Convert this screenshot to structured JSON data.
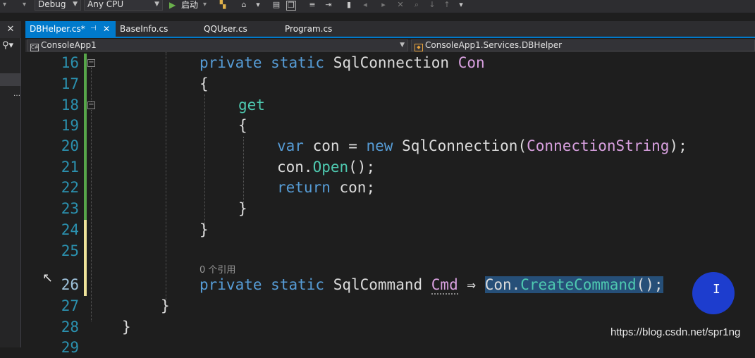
{
  "toolbar": {
    "config": "Debug",
    "platform": "Any CPU",
    "start_label": "启动"
  },
  "tabs": [
    {
      "label": "DBHelper.cs*",
      "active": true
    },
    {
      "label": "BaseInfo.cs"
    },
    {
      "label": "QQUser.cs"
    },
    {
      "label": "Program.cs"
    }
  ],
  "nav": {
    "project": "ConsoleApp1",
    "type": "ConsoleApp1.Services.DBHelper"
  },
  "code": {
    "line_numbers": [
      "16",
      "17",
      "18",
      "19",
      "20",
      "21",
      "22",
      "23",
      "24",
      "25",
      "26",
      "27",
      "28",
      "29"
    ],
    "codelens": "0 个引用",
    "l16_kw1": "private",
    "l16_kw2": "static",
    "l16_type": "SqlConnection",
    "l16_name": "Con",
    "l17": "{",
    "l18": "get",
    "l19": "{",
    "l20_kw": "var",
    "l20_var": "con",
    "l20_eq": "=",
    "l20_new": "new",
    "l20_type": "SqlConnection",
    "l20_open": "(",
    "l20_arg": "ConnectionString",
    "l20_close": ");",
    "l21_obj": "con.",
    "l21_m": "Open",
    "l21_end": "();",
    "l22_ret": "return",
    "l22_rest": "con;",
    "l23": "}",
    "l24": "}",
    "l26_kw1": "private",
    "l26_kw2": "static",
    "l26_type": "SqlCommand",
    "l26_name": "Cmd",
    "l26_arrow": "⇒",
    "l26_obj": "Con.",
    "l26_m": "CreateCommand",
    "l26_end": "();",
    "l27": "}",
    "l28": "}"
  },
  "watermark": "https://blog.csdn.net/spr1ng"
}
